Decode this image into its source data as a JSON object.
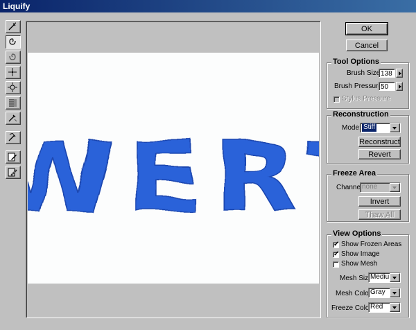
{
  "window": {
    "title": "Liquify"
  },
  "toolbar": {
    "tools": [
      {
        "name": "warp-tool-icon"
      },
      {
        "name": "twirl-clockwise-tool-icon",
        "active": true
      },
      {
        "name": "twirl-counterclockwise-tool-icon"
      },
      {
        "name": "pucker-tool-icon"
      },
      {
        "name": "bloat-tool-icon"
      },
      {
        "name": "shift-pixels-tool-icon"
      },
      {
        "name": "reflection-tool-icon"
      },
      {
        "name": "reconstruct-tool-icon"
      },
      {
        "name": "freeze-tool-icon"
      },
      {
        "name": "thaw-tool-icon"
      }
    ]
  },
  "preview": {
    "text": "WERT",
    "text_color": "#2a62d9"
  },
  "buttons": {
    "ok": "OK",
    "cancel": "Cancel"
  },
  "tool_options": {
    "title": "Tool Options",
    "brush_size_label": "Brush Size:",
    "brush_size": "138",
    "brush_pressure_label": "Brush Pressure:",
    "brush_pressure": "50",
    "stylus_pressure_label": "Stylus Pressure"
  },
  "reconstruction": {
    "title": "Reconstruction",
    "mode_label": "Mode:",
    "mode": "Stiff",
    "reconstruct_label": "Reconstruct",
    "revert_label": "Revert"
  },
  "freeze_area": {
    "title": "Freeze Area",
    "channel_label": "Channel:",
    "channel": "none",
    "invert_label": "Invert",
    "thaw_all_label": "Thaw All"
  },
  "view_options": {
    "title": "View Options",
    "show_frozen_label": "Show Frozen Areas",
    "show_frozen": true,
    "show_image_label": "Show Image",
    "show_image": true,
    "show_mesh_label": "Show Mesh",
    "show_mesh": false,
    "mesh_size_label": "Mesh Size:",
    "mesh_size": "Medium",
    "mesh_color_label": "Mesh Color:",
    "mesh_color": "Gray",
    "freeze_color_label": "Freeze Color:",
    "freeze_color": "Red"
  }
}
